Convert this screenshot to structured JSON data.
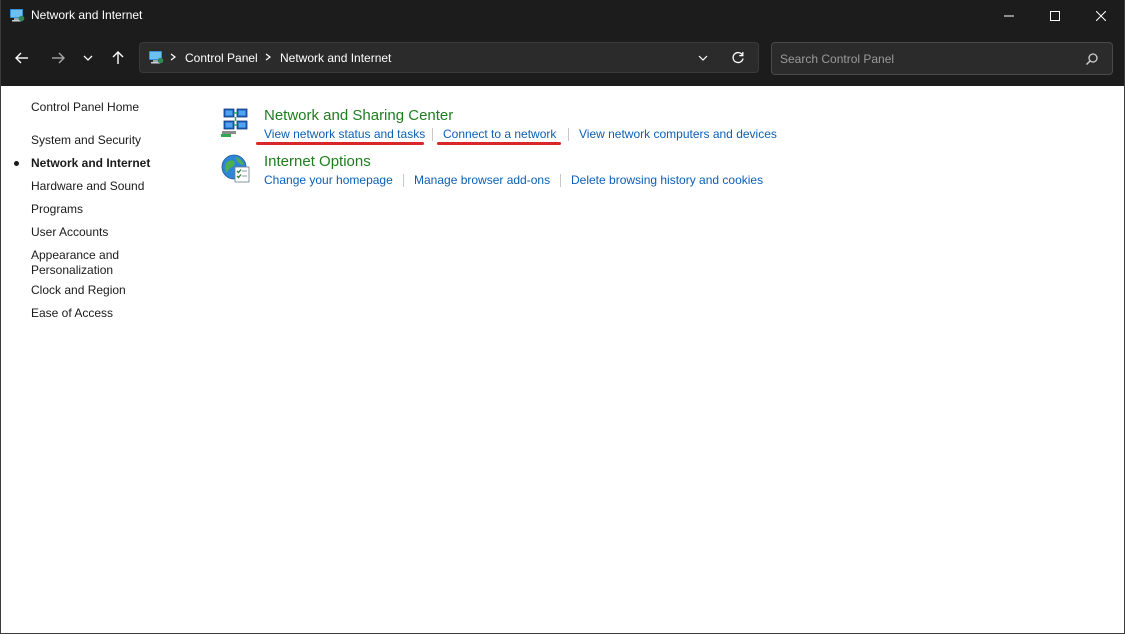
{
  "window": {
    "title": "Network and Internet"
  },
  "address": {
    "crumbs": [
      "Control Panel",
      "Network and Internet"
    ]
  },
  "search": {
    "placeholder": "Search Control Panel"
  },
  "sidebar": {
    "items": [
      {
        "label": "Control Panel Home",
        "active": false
      },
      {
        "label": "System and Security",
        "active": false
      },
      {
        "label": "Network and Internet",
        "active": true
      },
      {
        "label": "Hardware and Sound",
        "active": false
      },
      {
        "label": "Programs",
        "active": false
      },
      {
        "label": "User Accounts",
        "active": false
      },
      {
        "label": "Appearance and",
        "active": false
      },
      {
        "label": "Personalization",
        "active": false
      },
      {
        "label": "Clock and Region",
        "active": false
      },
      {
        "label": "Ease of Access",
        "active": false
      }
    ]
  },
  "categories": [
    {
      "title": "Network and Sharing Center",
      "icon": "network-sharing-icon",
      "links": [
        "View network status and tasks",
        "Connect to a network",
        "View network computers and devices"
      ]
    },
    {
      "title": "Internet Options",
      "icon": "internet-options-icon",
      "links": [
        "Change your homepage",
        "Manage browser add-ons",
        "Delete browsing history and cookies"
      ]
    }
  ],
  "colors": {
    "title_bar": "#1c1c1c",
    "category_title": "#1e7d1e",
    "link": "#0b5fb5",
    "annotation": "#d8262a"
  }
}
